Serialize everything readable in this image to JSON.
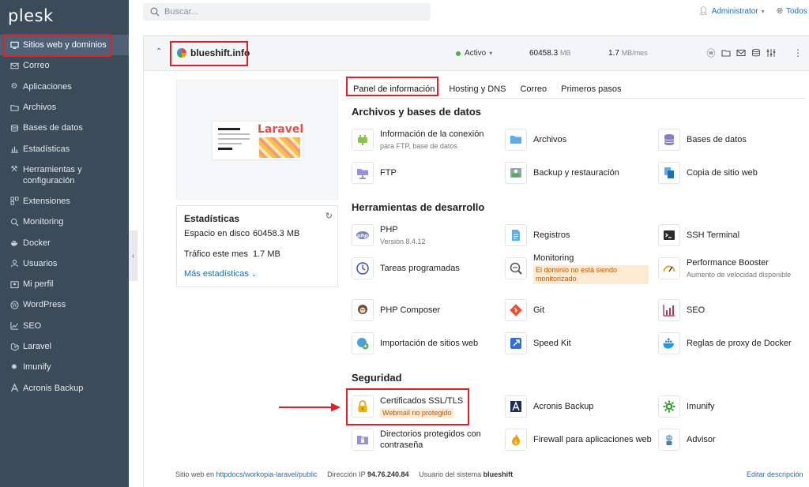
{
  "app": {
    "logo": "plesk"
  },
  "sidebar": {
    "items": [
      {
        "label": "Sitios web y dominios",
        "icon": "monitor-icon",
        "active": true
      },
      {
        "label": "Correo",
        "icon": "mail-icon"
      },
      {
        "label": "Aplicaciones",
        "icon": "gear-icon"
      },
      {
        "label": "Archivos",
        "icon": "folder-icon"
      },
      {
        "label": "Bases de datos",
        "icon": "database-icon"
      },
      {
        "label": "Estadísticas",
        "icon": "bar-chart-icon"
      },
      {
        "label": "Herramientas y configuración",
        "icon": "tools-icon"
      },
      {
        "label": "Extensiones",
        "icon": "extensions-icon"
      },
      {
        "label": "Monitoring",
        "icon": "monitoring-icon"
      },
      {
        "label": "Docker",
        "icon": "docker-icon"
      },
      {
        "label": "Usuarios",
        "icon": "users-icon"
      },
      {
        "label": "Mi perfil",
        "icon": "profile-icon"
      },
      {
        "label": "WordPress",
        "icon": "wordpress-icon"
      },
      {
        "label": "SEO",
        "icon": "seo-icon"
      },
      {
        "label": "Laravel",
        "icon": "laravel-icon"
      },
      {
        "label": "Imunify",
        "icon": "imunify-icon"
      },
      {
        "label": "Acronis Backup",
        "icon": "acronis-icon"
      }
    ]
  },
  "search": {
    "placeholder": "Buscar..."
  },
  "header": {
    "user": "Administrator",
    "subscriptions": "Todos"
  },
  "domain": {
    "name": "blueshift.info",
    "status": "Activo",
    "disk_value": "60458.3",
    "disk_unit": "MB",
    "traffic_value": "1.7",
    "traffic_unit": "MB/mes"
  },
  "stats": {
    "title": "Estadísticas",
    "disk_label": "Espacio en disco",
    "disk_value": "60458.3 MB",
    "traffic_label": "Tráfico este mes",
    "traffic_value": "1.7 MB",
    "more": "Más estadísticas"
  },
  "preview": {
    "brand": "Laravel"
  },
  "tabs": [
    "Panel de información",
    "Hosting y DNS",
    "Correo",
    "Primeros pasos"
  ],
  "sections": {
    "files": {
      "title": "Archivos y bases de datos",
      "tiles": [
        {
          "label": "Información de la conexión",
          "sub": "para FTP, base de datos",
          "icon": "connection-icon"
        },
        {
          "label": "Archivos",
          "icon": "folder-icon"
        },
        {
          "label": "Bases de datos",
          "icon": "database-icon"
        },
        {
          "label": "FTP",
          "icon": "ftp-icon"
        },
        {
          "label": "Backup y restauración",
          "icon": "backup-icon"
        },
        {
          "label": "Copia de sitio web",
          "icon": "copy-icon"
        }
      ]
    },
    "dev": {
      "title": "Herramientas de desarrollo",
      "tiles": [
        {
          "label": "PHP",
          "sub": "Versión 8.4.12",
          "icon": "php-icon"
        },
        {
          "label": "Registros",
          "icon": "logs-icon"
        },
        {
          "label": "SSH Terminal",
          "icon": "terminal-icon"
        },
        {
          "label": "Tareas programadas",
          "icon": "clock-icon"
        },
        {
          "label": "Monitoring",
          "warn": "El dominio no está siendo monitorizado",
          "icon": "monitoring-icon"
        },
        {
          "label": "Performance Booster",
          "sub": "Aumento de velocidad disponible",
          "icon": "gauge-icon"
        },
        {
          "label": "PHP Composer",
          "icon": "composer-icon"
        },
        {
          "label": "Git",
          "icon": "git-icon"
        },
        {
          "label": "SEO",
          "icon": "seo-icon"
        },
        {
          "label": "Importación de sitios web",
          "icon": "import-icon"
        },
        {
          "label": "Speed Kit",
          "icon": "rocket-icon"
        },
        {
          "label": "Reglas de proxy de Docker",
          "icon": "docker-icon"
        }
      ]
    },
    "security": {
      "title": "Seguridad",
      "tiles": [
        {
          "label": "Certificados SSL/TLS",
          "warn": "Webmail no protegido",
          "icon": "lock-icon"
        },
        {
          "label": "Acronis Backup",
          "icon": "acronis-icon"
        },
        {
          "label": "Imunify",
          "icon": "imunify-icon"
        },
        {
          "label": "Directorios protegidos con contraseña",
          "icon": "protected-folder-icon"
        },
        {
          "label": "Firewall para aplicaciones web",
          "icon": "fire-icon"
        },
        {
          "label": "Advisor",
          "icon": "advisor-icon"
        }
      ]
    }
  },
  "footer": {
    "web_prefix": "Sitio web en",
    "web_path": "httpdocs/workopia-laravel/public",
    "ip_label": "Dirección IP",
    "ip": "94.76.240.84",
    "user_label": "Usuario del sistema",
    "user": "blueshift",
    "edit": "Editar descripción"
  },
  "colors": {
    "sidebar": "#3c4b5a",
    "accent": "#1f6fb2",
    "highlight": "#e01f26",
    "active_status": "#4fb34a",
    "warning_bg": "#fcebd2"
  }
}
